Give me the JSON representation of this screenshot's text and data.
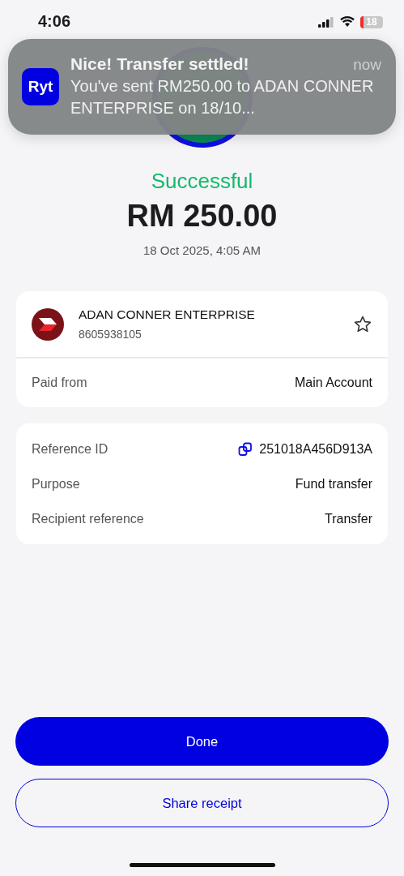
{
  "status_bar": {
    "time": "4:06",
    "battery": "18"
  },
  "notification": {
    "app_icon": "Ryt",
    "title": "Nice! Transfer settled!",
    "time": "now",
    "body": "You've sent RM250.00 to ADAN CONNER ENTERPRISE on 18/10..."
  },
  "result": {
    "status": "Successful",
    "amount": "RM 250.00",
    "datetime": "18 Oct 2025, 4:05 AM"
  },
  "recipient": {
    "name": "ADAN CONNER ENTERPRISE",
    "account": "8605938105",
    "favourite": false
  },
  "paid_from": {
    "label": "Paid from",
    "value": "Main Account"
  },
  "details": [
    {
      "kind": "copy",
      "label": "Reference ID",
      "value": "251018A456D913A"
    },
    {
      "kind": "plain",
      "label": "Purpose",
      "value": "Fund transfer"
    },
    {
      "kind": "plain",
      "label": "Recipient reference",
      "value": "Transfer"
    }
  ],
  "buttons": [
    {
      "kind": "primary",
      "label": "Done"
    },
    {
      "kind": "secondary",
      "label": "Share receipt"
    }
  ]
}
